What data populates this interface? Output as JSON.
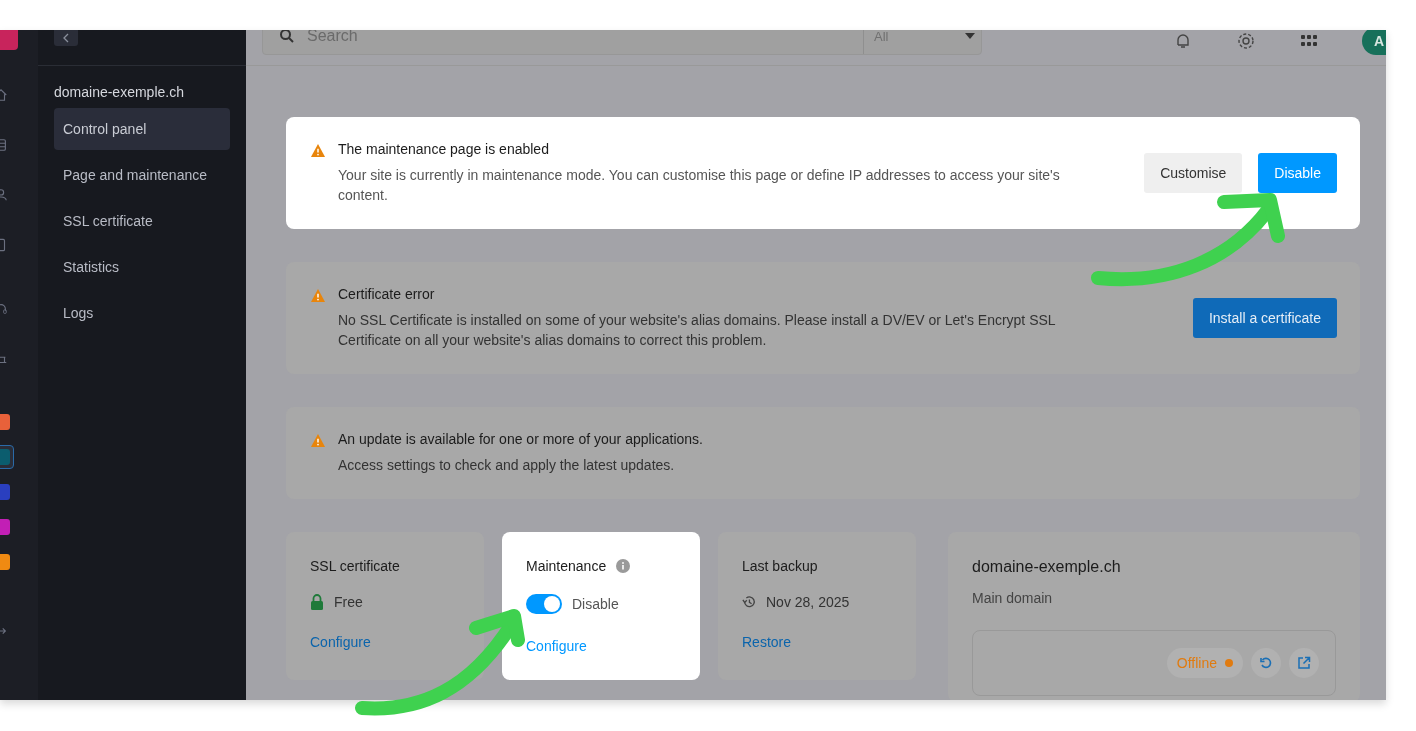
{
  "topbar": {
    "search": {
      "placeholder": "Search"
    },
    "scope": "All",
    "avatar": "A"
  },
  "rail": {
    "apps": [
      {
        "color": "#e8613a",
        "selected": false
      },
      {
        "color": "#0b5d6e",
        "selected": true
      },
      {
        "color": "#2a3fbf",
        "selected": false
      },
      {
        "color": "#c21fb5",
        "selected": false
      },
      {
        "color": "#f08a12",
        "selected": false
      }
    ]
  },
  "sidebar": {
    "title": "domaine-exemple.ch",
    "items": [
      {
        "label": "Control panel",
        "selected": true
      },
      {
        "label": "Page and maintenance",
        "selected": false
      },
      {
        "label": "SSL certificate",
        "selected": false
      },
      {
        "label": "Statistics",
        "selected": false
      },
      {
        "label": "Logs",
        "selected": false
      }
    ]
  },
  "alerts": [
    {
      "title": "The maintenance page is enabled",
      "text": "Your site is currently in maintenance mode. You can customise this page or define IP addresses to access your site's content.",
      "highlighted": true,
      "buttons": [
        {
          "label": "Customise",
          "kind": "secondary"
        },
        {
          "label": "Disable",
          "kind": "primary"
        }
      ]
    },
    {
      "title": "Certificate error",
      "text": "No SSL Certificate is installed on some of your website's alias domains. Please install a DV/EV or Let's Encrypt SSL Certificate on all your website's alias domains to correct this problem.",
      "highlighted": false,
      "buttons": [
        {
          "label": "Install a certificate",
          "kind": "primary"
        }
      ]
    },
    {
      "title": "An update is available for one or more of your applications.",
      "text": "Access settings to check and apply the latest updates.",
      "highlighted": false
    }
  ],
  "cards": [
    {
      "kind": "ssl",
      "title": "SSL certificate",
      "value": "Free",
      "link": "Configure",
      "highlighted": false
    },
    {
      "kind": "maintenance",
      "title": "Maintenance",
      "value": "Disable",
      "on": true,
      "link": "Configure",
      "highlighted": true
    },
    {
      "kind": "backup",
      "title": "Last backup",
      "value": "Nov 28, 2025",
      "link": "Restore",
      "highlighted": false
    }
  ],
  "domain": {
    "name": "domaine-exemple.ch",
    "subtitle": "Main domain",
    "status": {
      "label": "Offline",
      "color": "#e07b10"
    }
  }
}
